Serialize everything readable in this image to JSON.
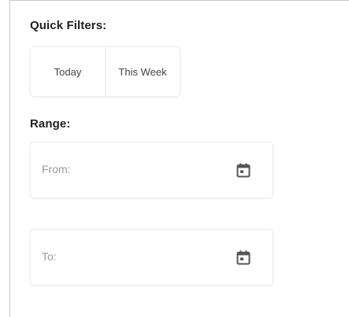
{
  "quick_filters": {
    "title": "Quick Filters:",
    "buttons": [
      {
        "label": "Today"
      },
      {
        "label": "This Week"
      }
    ]
  },
  "range": {
    "title": "Range:",
    "from": {
      "placeholder": "From:",
      "icon": "calendar-icon"
    },
    "to": {
      "placeholder": "To:",
      "icon": "calendar-icon"
    }
  },
  "colors": {
    "text": "#1f1f1f",
    "placeholder": "#9a9a9a",
    "border": "#ececec",
    "icon": "#555555"
  }
}
